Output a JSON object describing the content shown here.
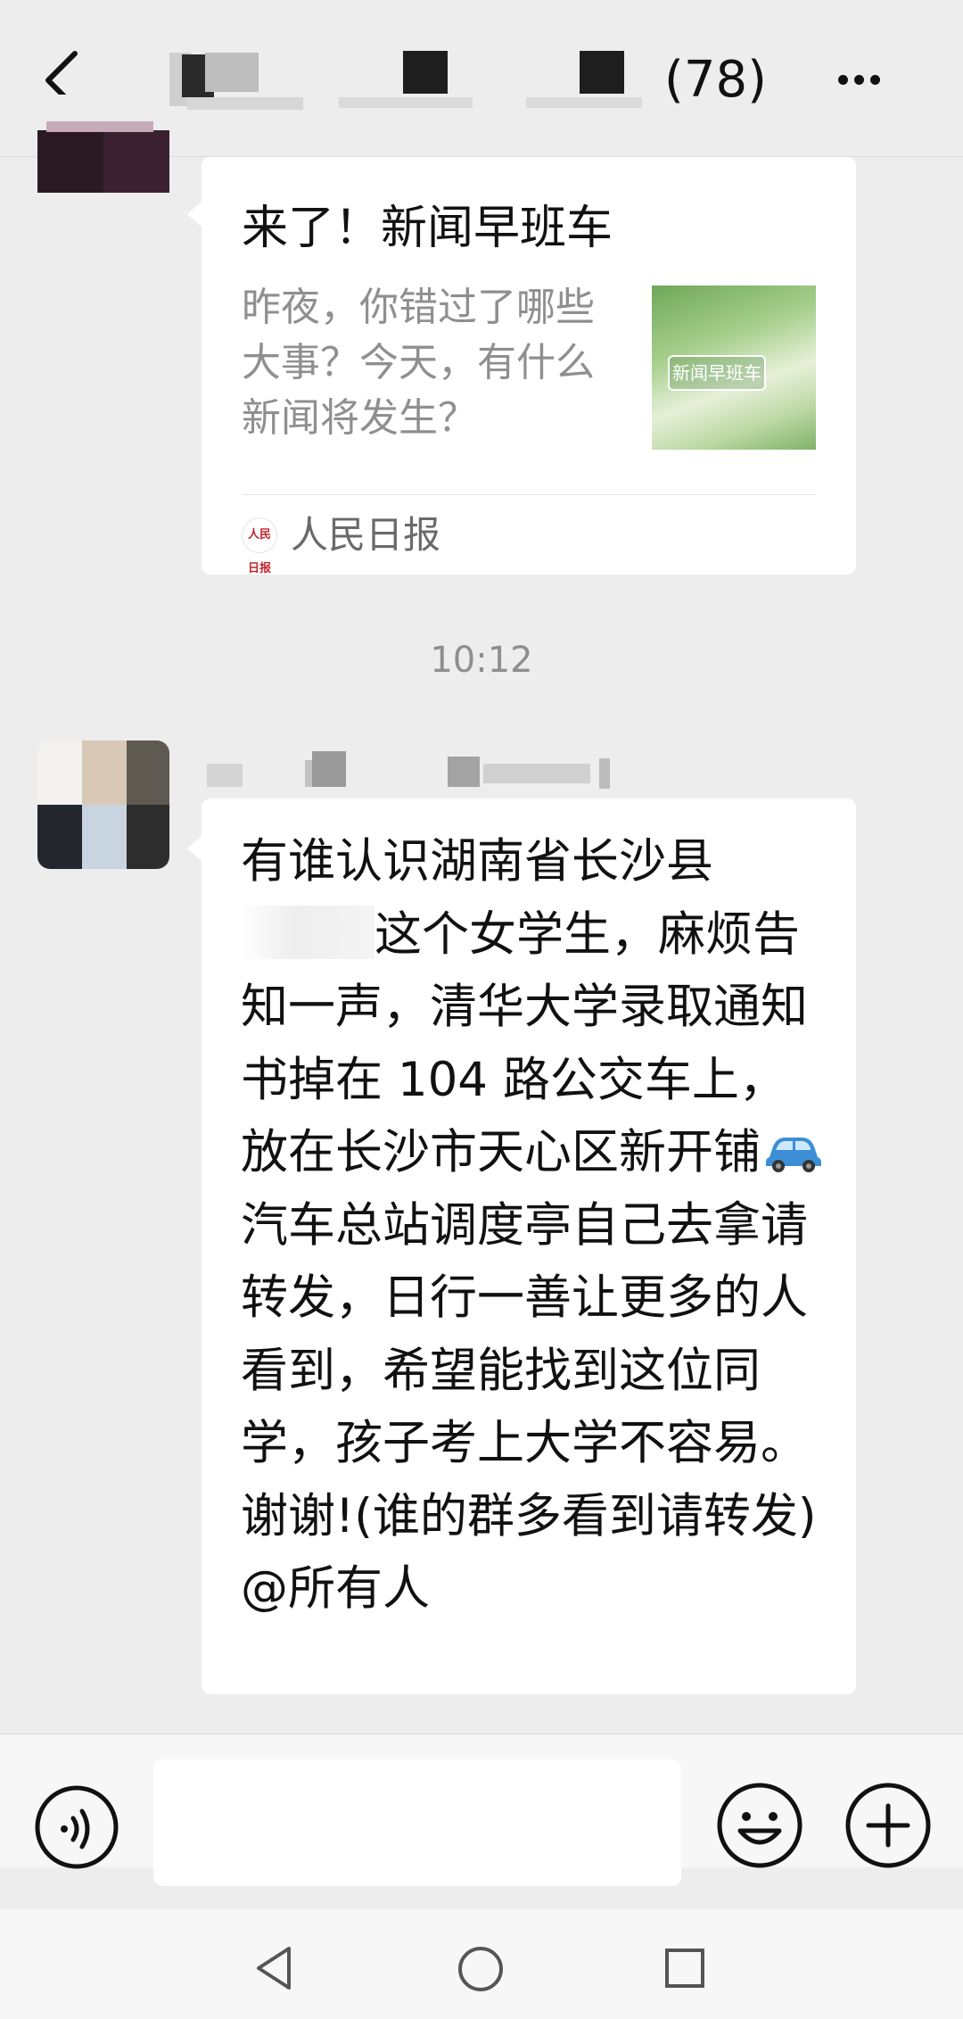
{
  "header": {
    "member_count": "(78)",
    "back_icon": "chevron-left-icon",
    "more_icon": "more-horizontal-icon"
  },
  "messages": {
    "article_card": {
      "title": "来了！新闻早班车",
      "description": "昨夜，你错过了哪些大事？今天，有什么新闻将发生？",
      "thumbnail_label": "新闻早班车",
      "source_logo": "人民日报",
      "source": "人民日报"
    },
    "timestamp": "10:12",
    "text_message": {
      "part1": "有谁认识湖南省长沙县",
      "part2": "这个女学生，麻烦告知一声，清华大学录取通知书掉在 104 路公交车上，放在长沙市天心区新开铺",
      "emoji": "car-icon",
      "part3": " 汽车总站调度亭自己去拿请转发，日行一善让更多的人看到，希望能找到这位同学，孩子考上大学不容易。谢谢!(谁的群多看到请转发)@所有人"
    }
  },
  "input_bar": {
    "voice_icon": "voice-icon",
    "emoji_icon": "emoji-icon",
    "plus_icon": "plus-icon",
    "input_value": ""
  },
  "nav_bar": {
    "back": "nav-back-icon",
    "home": "nav-home-icon",
    "recents": "nav-recents-icon"
  },
  "colors": {
    "background": "#ededed",
    "bubble": "#ffffff",
    "secondary_text": "#8f8f8f"
  }
}
